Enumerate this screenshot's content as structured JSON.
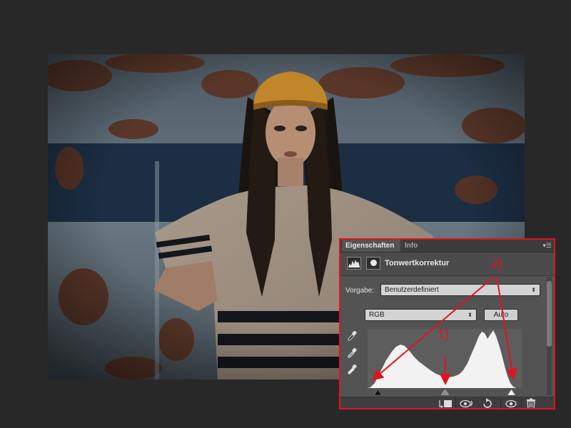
{
  "panel": {
    "tabs": [
      {
        "label": "Eigenschaften",
        "active": true
      },
      {
        "label": "Info",
        "active": false
      }
    ],
    "adjustment_title": "Tonwertkorrektur",
    "preset_label": "Vorgabe:",
    "preset_value": "Benutzerdefiniert",
    "channel_value": "RGB",
    "auto_label": "Auto",
    "eyedroppers": [
      "eyedropper-black-icon",
      "eyedropper-gray-icon",
      "eyedropper-white-icon"
    ],
    "bottom_icons": [
      "clip-to-layer-icon",
      "view-previous-icon",
      "reset-icon",
      "visibility-icon",
      "trash-icon"
    ]
  },
  "annotations": {
    "label_1": "1)",
    "label_2": "2)",
    "color": "#e0141e"
  }
}
